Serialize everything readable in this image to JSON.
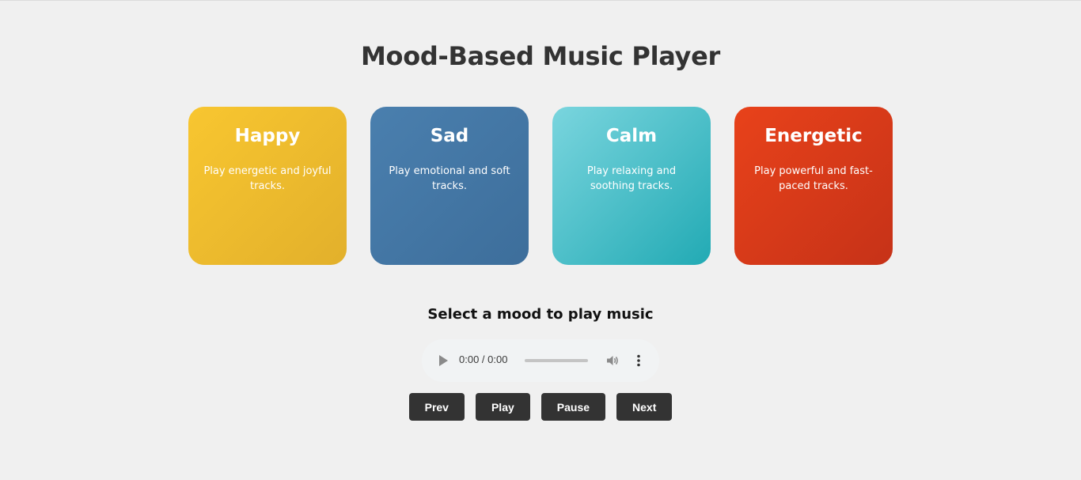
{
  "page": {
    "title": "Mood-Based Music Player"
  },
  "moods": [
    {
      "name": "Happy",
      "description": "Play energetic and joyful tracks.",
      "color": "#f8c630"
    },
    {
      "name": "Sad",
      "description": "Play emotional and soft tracks.",
      "color": "#4a7fae"
    },
    {
      "name": "Calm",
      "description": "Play relaxing and soothing tracks.",
      "color": "#4fc0c9"
    },
    {
      "name": "Energetic",
      "description": "Play powerful and fast-paced tracks.",
      "color": "#e03d19"
    }
  ],
  "player": {
    "status": "Select a mood to play music",
    "time": "0:00 / 0:00",
    "icons": {
      "play": "play-icon",
      "volume": "volume-icon",
      "more": "more-options-icon"
    }
  },
  "controls": {
    "prev_label": "Prev",
    "play_label": "Play",
    "pause_label": "Pause",
    "next_label": "Next",
    "button_color": "#333333"
  }
}
